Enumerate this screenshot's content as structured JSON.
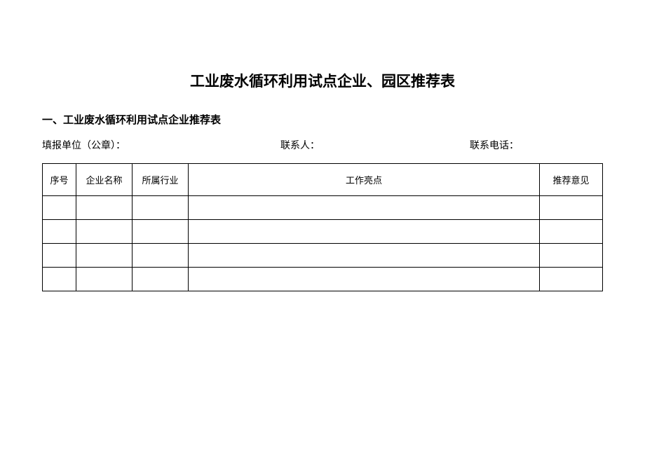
{
  "title": "工业废水循环利用试点企业、园区推荐表",
  "subtitle": "一、工业废水循环利用试点企业推荐表",
  "info": {
    "unit_label": "填报单位（公章）：",
    "contact_label": "联系人：",
    "phone_label": "联系电话："
  },
  "table": {
    "headers": {
      "seq": "序号",
      "name": "企业名称",
      "industry": "所属行业",
      "highlight": "工作亮点",
      "opinion": "推荐意见"
    },
    "rows": [
      {
        "seq": "",
        "name": "",
        "industry": "",
        "highlight": "",
        "opinion": ""
      },
      {
        "seq": "",
        "name": "",
        "industry": "",
        "highlight": "",
        "opinion": ""
      },
      {
        "seq": "",
        "name": "",
        "industry": "",
        "highlight": "",
        "opinion": ""
      },
      {
        "seq": "",
        "name": "",
        "industry": "",
        "highlight": "",
        "opinion": ""
      }
    ]
  }
}
